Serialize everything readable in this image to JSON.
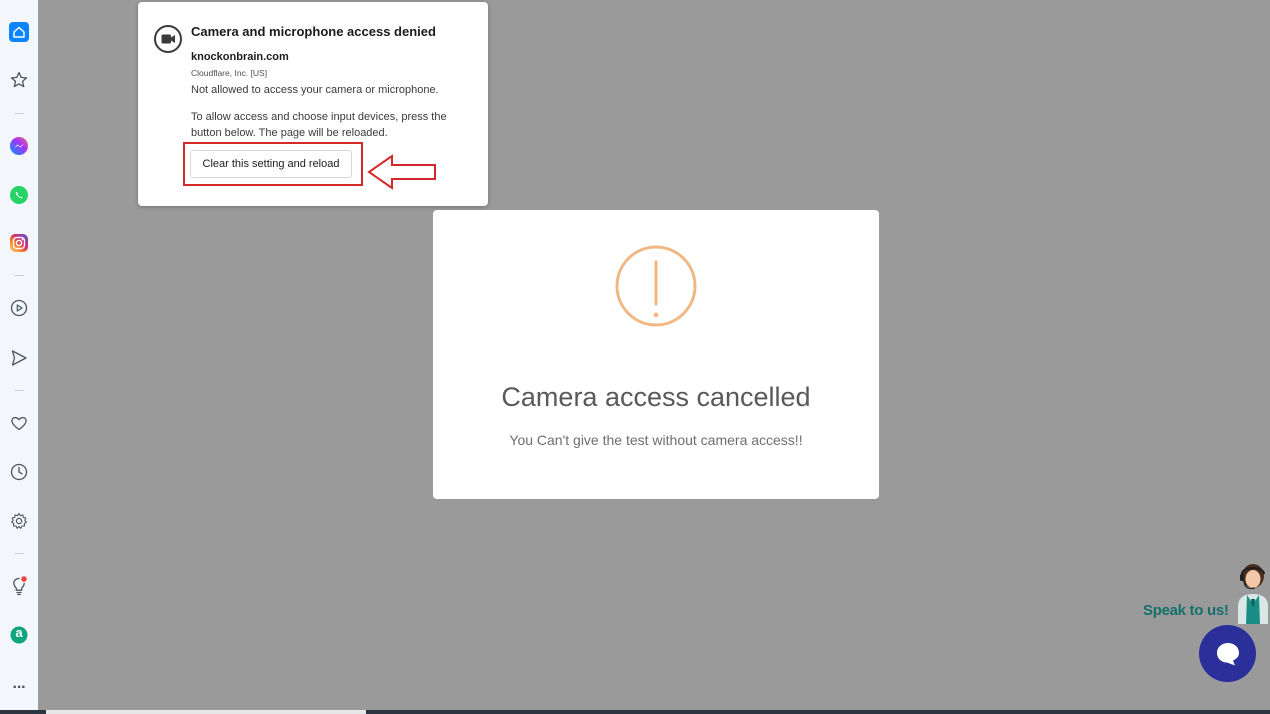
{
  "sidebar": {
    "items": [
      {
        "icon": "home-icon"
      },
      {
        "icon": "star-icon"
      },
      {
        "icon": "messenger-icon"
      },
      {
        "icon": "whatsapp-icon"
      },
      {
        "icon": "instagram-icon"
      },
      {
        "icon": "play-icon"
      },
      {
        "icon": "send-icon"
      },
      {
        "icon": "heart-icon"
      },
      {
        "icon": "clock-icon"
      },
      {
        "icon": "gear-icon"
      },
      {
        "icon": "lightbulb-icon"
      },
      {
        "icon": "app-a-icon"
      },
      {
        "icon": "more-icon"
      }
    ],
    "more_label": "···",
    "app_a_label": "a"
  },
  "permission_popup": {
    "title": "Camera and microphone access denied",
    "site": "knockonbrain.com",
    "org": "Cloudflare, Inc. [US]",
    "not_allowed": "Not allowed to access your camera or microphone.",
    "instructions": "To allow access and choose input devices, press the button below. The page will be reloaded.",
    "button_label": "Clear this setting and reload"
  },
  "modal": {
    "title": "Camera access cancelled",
    "message": "You Can't give the test without camera access!!",
    "icon_color": "#f1b884"
  },
  "support": {
    "speak_label": "Speak to us!"
  },
  "colors": {
    "accent": "#0a84ff",
    "highlight": "#d62828",
    "chat_button": "#2a2f9a",
    "speak_text": "#14706b"
  }
}
